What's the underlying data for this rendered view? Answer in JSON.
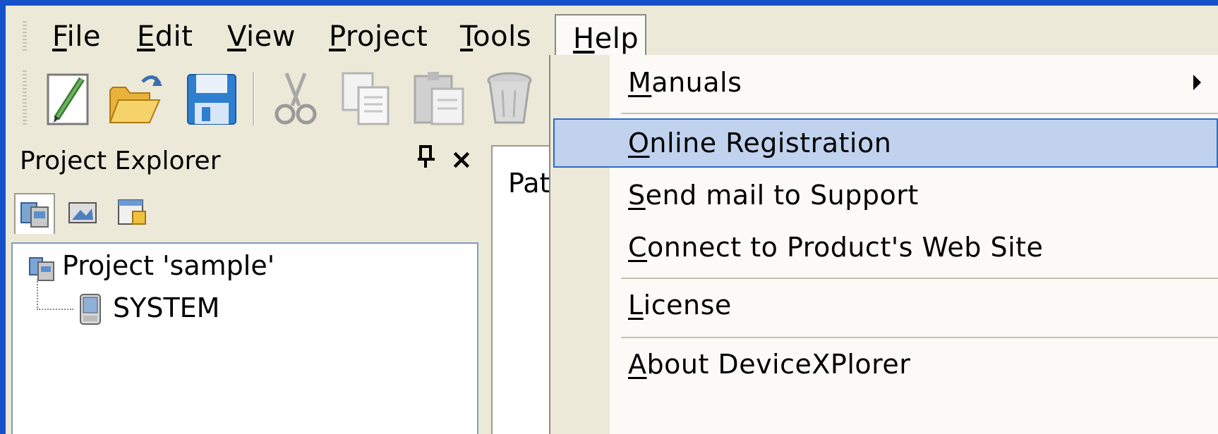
{
  "menubar": {
    "items": [
      {
        "prefix": "",
        "key": "F",
        "rest": "ile"
      },
      {
        "prefix": "",
        "key": "E",
        "rest": "dit"
      },
      {
        "prefix": "",
        "key": "V",
        "rest": "iew"
      },
      {
        "prefix": "",
        "key": "P",
        "rest": "roject"
      },
      {
        "prefix": "",
        "key": "T",
        "rest": "ools"
      },
      {
        "prefix": "",
        "key": "H",
        "rest": "elp"
      }
    ]
  },
  "toolbar": {
    "icons": [
      "new-icon",
      "open-folder-icon",
      "save-icon",
      "cut-icon",
      "copy-icon",
      "paste-icon",
      "delete-icon"
    ]
  },
  "project_explorer": {
    "title": "Project Explorer",
    "pin_glyph": "Ⅰ",
    "close_glyph": "×",
    "tree": {
      "root": "Project 'sample'",
      "child": "SYSTEM"
    }
  },
  "document": {
    "tab_label": "Path"
  },
  "help_menu": {
    "items": [
      {
        "key": "M",
        "rest": "anuals",
        "submenu": true
      },
      {
        "key": "O",
        "rest": "nline Registration",
        "highlighted": true
      },
      {
        "key": "S",
        "rest": "end mail to Support"
      },
      {
        "key": "C",
        "rest": "onnect to Product's Web Site"
      },
      {
        "key": "L",
        "rest": "icense"
      },
      {
        "key": "A",
        "rest": "bout DeviceXPlorer"
      }
    ]
  },
  "colors": {
    "highlight_bg": "#c1d2ee",
    "highlight_border": "#316ac5",
    "window_border": "#1552c9"
  }
}
